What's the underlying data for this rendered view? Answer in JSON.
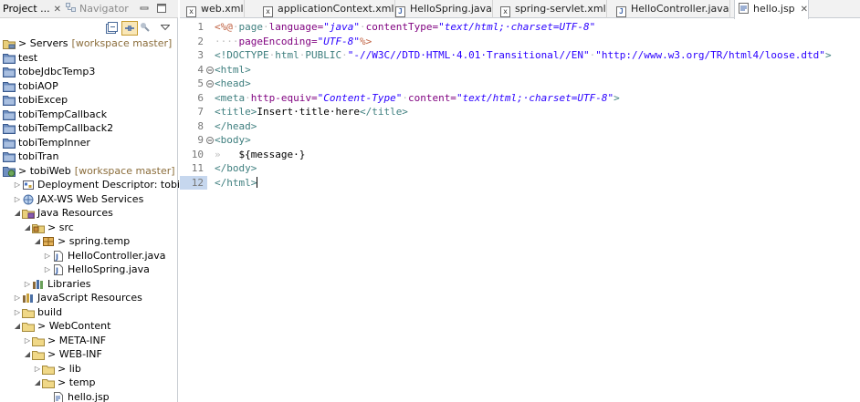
{
  "left_panel": {
    "tabs": [
      {
        "label": "Project ...",
        "close": "✕",
        "active": true
      },
      {
        "label": "Navigator",
        "active": false
      }
    ],
    "tree": [
      {
        "indent": 0,
        "twisty": "",
        "icon": "server-folder-icon",
        "label": "> Servers",
        "tag": "[workspace master]"
      },
      {
        "indent": 0,
        "twisty": "",
        "icon": "project-icon",
        "label": "test",
        "tag": ""
      },
      {
        "indent": 0,
        "twisty": "",
        "icon": "project-icon",
        "label": "tobeJdbcTemp3",
        "tag": ""
      },
      {
        "indent": 0,
        "twisty": "",
        "icon": "project-icon",
        "label": "tobiAOP",
        "tag": ""
      },
      {
        "indent": 0,
        "twisty": "",
        "icon": "project-icon",
        "label": "tobiExcep",
        "tag": ""
      },
      {
        "indent": 0,
        "twisty": "",
        "icon": "project-icon",
        "label": "tobiTempCallback",
        "tag": ""
      },
      {
        "indent": 0,
        "twisty": "",
        "icon": "project-icon",
        "label": "tobiTempCallback2",
        "tag": ""
      },
      {
        "indent": 0,
        "twisty": "",
        "icon": "project-icon",
        "label": "tobiTempInner",
        "tag": ""
      },
      {
        "indent": 0,
        "twisty": "",
        "icon": "project-icon",
        "label": "tobiTran",
        "tag": ""
      },
      {
        "indent": 0,
        "twisty": "",
        "icon": "web-project-icon",
        "label": "> tobiWeb",
        "tag": "[workspace master]"
      },
      {
        "indent": 1,
        "twisty": "▷",
        "icon": "deployment-descriptor-icon",
        "label": "Deployment Descriptor: tobiWeb",
        "tag": ""
      },
      {
        "indent": 1,
        "twisty": "▷",
        "icon": "web-services-icon",
        "label": "JAX-WS Web Services",
        "tag": ""
      },
      {
        "indent": 1,
        "twisty": "◢",
        "icon": "java-resources-icon",
        "label": "Java Resources",
        "tag": ""
      },
      {
        "indent": 2,
        "twisty": "◢",
        "icon": "source-folder-icon",
        "label": "> src",
        "tag": ""
      },
      {
        "indent": 3,
        "twisty": "◢",
        "icon": "package-icon",
        "label": "> spring.temp",
        "tag": ""
      },
      {
        "indent": 4,
        "twisty": "▷",
        "icon": "java-file-icon",
        "label": "HelloController.java",
        "tag": ""
      },
      {
        "indent": 4,
        "twisty": "▷",
        "icon": "java-file-icon",
        "label": "HelloSpring.java",
        "tag": ""
      },
      {
        "indent": 2,
        "twisty": "▷",
        "icon": "libraries-icon",
        "label": "Libraries",
        "tag": ""
      },
      {
        "indent": 1,
        "twisty": "▷",
        "icon": "javascript-resources-icon",
        "label": "JavaScript Resources",
        "tag": ""
      },
      {
        "indent": 1,
        "twisty": "▷",
        "icon": "folder-icon",
        "label": "build",
        "tag": ""
      },
      {
        "indent": 1,
        "twisty": "◢",
        "icon": "folder-icon",
        "label": "> WebContent",
        "tag": ""
      },
      {
        "indent": 2,
        "twisty": "▷",
        "icon": "folder-icon",
        "label": "> META-INF",
        "tag": ""
      },
      {
        "indent": 2,
        "twisty": "◢",
        "icon": "folder-icon",
        "label": "> WEB-INF",
        "tag": ""
      },
      {
        "indent": 3,
        "twisty": "▷",
        "icon": "folder-icon",
        "label": "> lib",
        "tag": ""
      },
      {
        "indent": 3,
        "twisty": "◢",
        "icon": "folder-icon",
        "label": "> temp",
        "tag": ""
      },
      {
        "indent": 4,
        "twisty": "",
        "icon": "jsp-file-icon",
        "label": "hello.jsp",
        "tag": ""
      }
    ]
  },
  "editor": {
    "tabs": [
      {
        "label": "web.xml",
        "icon": "x",
        "active": false
      },
      {
        "label": "applicationContext.xml",
        "icon": "x",
        "active": false
      },
      {
        "label": "HelloSpring.java",
        "icon": "J",
        "active": false
      },
      {
        "label": "spring-servlet.xml",
        "icon": "x",
        "active": false
      },
      {
        "label": "HelloController.java",
        "icon": "J",
        "active": false
      },
      {
        "label": "hello.jsp",
        "icon": "",
        "active": true,
        "close": "✕"
      }
    ],
    "lines": [
      {
        "num": "1",
        "fold": ""
      },
      {
        "num": "2",
        "fold": ""
      },
      {
        "num": "3",
        "fold": ""
      },
      {
        "num": "4",
        "fold": "⊖"
      },
      {
        "num": "5",
        "fold": "⊖"
      },
      {
        "num": "6",
        "fold": ""
      },
      {
        "num": "7",
        "fold": ""
      },
      {
        "num": "8",
        "fold": ""
      },
      {
        "num": "9",
        "fold": "⊖"
      },
      {
        "num": "10",
        "fold": ""
      },
      {
        "num": "11",
        "fold": ""
      },
      {
        "num": "12",
        "fold": ""
      }
    ],
    "code": {
      "l1": {
        "open": "<%@",
        "sp1": "·",
        "page": "page",
        "sp2": "·",
        "lang_attr": "language=",
        "lang_val": "\"java\"",
        "sp3": "·",
        "ct_attr": "contentType=",
        "ct_val": "\"text/html;·charset=UTF-8\""
      },
      "l2": {
        "indent": "····",
        "pe_attr": "pageEncoding=",
        "pe_val": "\"UTF-8\"",
        "close": "%>"
      },
      "l3": {
        "open": "<!DOCTYPE",
        "sp": "·",
        "html": "html",
        "sp2": "·",
        "public": "PUBLIC",
        "sp3": "·",
        "fpi": "\"-//W3C//DTD·HTML·4.01·Transitional//EN\"",
        "sp4": "·",
        "url": "\"http://www.w3.org/TR/html4/loose.dtd\"",
        "close": ">"
      },
      "l4": "<html>",
      "l5": "<head>",
      "l6": {
        "open": "<meta",
        "sp": "·",
        "he_attr": "http-equiv=",
        "he_val": "\"Content-Type\"",
        "sp2": "·",
        "c_attr": "content=",
        "c_val": "\"text/html;·charset=UTF-8\"",
        "close": ">"
      },
      "l7": {
        "open": "<title>",
        "text": "Insert·title·here",
        "close": "</title>"
      },
      "l8": "</head>",
      "l9": "<body>",
      "l10": {
        "tab": "»   ",
        "expr": "${message·}"
      },
      "l11": "</body>",
      "l12": "</html>"
    }
  }
}
